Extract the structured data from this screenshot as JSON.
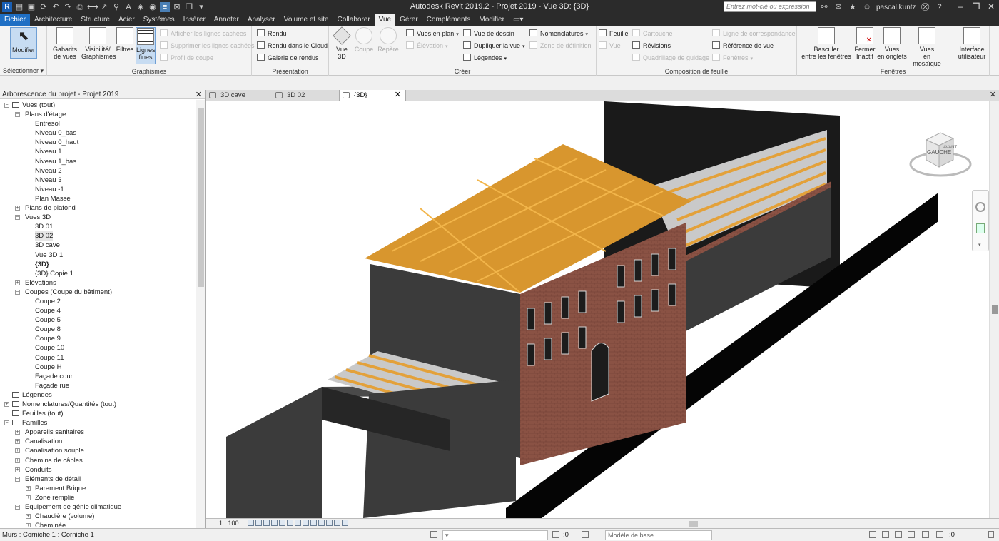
{
  "titlebar": {
    "title": "Autodesk Revit 2019.2 - Projet 2019 - Vue 3D: {3D}",
    "search_placeholder": "Entrez mot-clé ou expression",
    "user": "pascal.kuntz",
    "help": "?"
  },
  "menu": [
    "Fichier",
    "Architecture",
    "Structure",
    "Acier",
    "Systèmes",
    "Insérer",
    "Annoter",
    "Analyser",
    "Volume et site",
    "Collaborer",
    "Vue",
    "Gérer",
    "Compléments",
    "Modifier"
  ],
  "menu_active": "Vue",
  "ribbon": {
    "selectionner": {
      "modifier": "Modifier",
      "label": "Sélectionner"
    },
    "graphismes": {
      "label": "Graphismes",
      "gabarits": [
        "Gabarits",
        "de vues"
      ],
      "visibilite": [
        "Visibilité/",
        "Graphismes"
      ],
      "filtres": "Filtres",
      "lignes": [
        "Lignes",
        "fines"
      ],
      "afficher": "Afficher les lignes cachées",
      "supprimer": "Supprimer les lignes cachées",
      "profil": "Profil de coupe"
    },
    "presentation": {
      "label": "Présentation",
      "rendu": "Rendu",
      "rendu_cloud": "Rendu  dans le Cloud",
      "galerie": "Galerie  de rendus"
    },
    "creer": {
      "label": "Créer",
      "vue3d": [
        "Vue",
        "3D"
      ],
      "coupe": "Coupe",
      "repere": "Repère",
      "vues_plan": "Vues en plan",
      "elevation": "Élévation",
      "vue_dessin": "Vue de dessin",
      "dupliquer": "Dupliquer la vue",
      "legendes": "Légendes",
      "nomenclatures": "Nomenclatures",
      "zone_def": "Zone de définition"
    },
    "composition": {
      "label": "Composition de feuille",
      "feuille": "Feuille",
      "vue": "Vue",
      "cartouche": "Cartouche",
      "revisions": "Révisions",
      "quadrillage": "Quadrillage de guidage",
      "ligne_corr": "Ligne de correspondance",
      "reference": "Référence de vue",
      "fenetres_dd": "Fenêtres"
    },
    "fenetres": {
      "label": "Fenêtres",
      "basculer": [
        "Basculer",
        "entre les fenêtres"
      ],
      "fermer": [
        "Fermer",
        "Inactif"
      ],
      "onglets": [
        "Vues",
        "en onglets"
      ],
      "mosaique": [
        "Vues",
        "en mosaïque"
      ],
      "interface": [
        "Interface",
        "utilisateur"
      ]
    }
  },
  "browser": {
    "title": "Arborescence du projet - Projet 2019",
    "nodes": [
      {
        "label": "Vues (tout)",
        "level": 0,
        "exp": "−",
        "icon": "views-icon"
      },
      {
        "label": "Plans d'étage",
        "level": 1,
        "exp": "−"
      },
      {
        "label": "Entresol",
        "level": 2
      },
      {
        "label": "Niveau 0_bas",
        "level": 2
      },
      {
        "label": "Niveau 0_haut",
        "level": 2
      },
      {
        "label": "Niveau 1",
        "level": 2
      },
      {
        "label": "Niveau 1_bas",
        "level": 2
      },
      {
        "label": "Niveau 2",
        "level": 2
      },
      {
        "label": "Niveau 3",
        "level": 2
      },
      {
        "label": "Niveau -1",
        "level": 2
      },
      {
        "label": "Plan Masse",
        "level": 2
      },
      {
        "label": "Plans de plafond",
        "level": 1,
        "exp": "+"
      },
      {
        "label": "Vues 3D",
        "level": 1,
        "exp": "−"
      },
      {
        "label": "3D 01",
        "level": 2
      },
      {
        "label": "3D 02",
        "level": 2,
        "hl": true
      },
      {
        "label": "3D cave",
        "level": 2
      },
      {
        "label": "Vue 3D 1",
        "level": 2
      },
      {
        "label": "{3D}",
        "level": 2,
        "bold": true
      },
      {
        "label": "{3D} Copie 1",
        "level": 2
      },
      {
        "label": "Elévations",
        "level": 1,
        "exp": "+"
      },
      {
        "label": "Coupes (Coupe du bâtiment)",
        "level": 1,
        "exp": "−"
      },
      {
        "label": "Coupe 2",
        "level": 2
      },
      {
        "label": "Coupe 4",
        "level": 2
      },
      {
        "label": "Coupe 5",
        "level": 2
      },
      {
        "label": "Coupe 8",
        "level": 2
      },
      {
        "label": "Coupe 9",
        "level": 2
      },
      {
        "label": "Coupe 10",
        "level": 2
      },
      {
        "label": "Coupe 11",
        "level": 2
      },
      {
        "label": "Coupe H",
        "level": 2
      },
      {
        "label": "Façade cour",
        "level": 2
      },
      {
        "label": "Façade rue",
        "level": 2
      },
      {
        "label": "Légendes",
        "level": 0,
        "icon": "legend-icon"
      },
      {
        "label": "Nomenclatures/Quantités (tout)",
        "level": 0,
        "exp": "+",
        "icon": "schedule-icon"
      },
      {
        "label": "Feuilles (tout)",
        "level": 0,
        "icon": "sheet-icon"
      },
      {
        "label": "Familles",
        "level": 0,
        "exp": "−",
        "icon": "family-icon"
      },
      {
        "label": "Appareils sanitaires",
        "level": 1,
        "exp": "+"
      },
      {
        "label": "Canalisation",
        "level": 1,
        "exp": "+"
      },
      {
        "label": "Canalisation souple",
        "level": 1,
        "exp": "+"
      },
      {
        "label": "Chemins de câbles",
        "level": 1,
        "exp": "+"
      },
      {
        "label": "Conduits",
        "level": 1,
        "exp": "+"
      },
      {
        "label": "Eléments de détail",
        "level": 1,
        "exp": "−"
      },
      {
        "label": "Parement Brique",
        "level": 2,
        "exp": "+"
      },
      {
        "label": "Zone remplie",
        "level": 2,
        "exp": "+"
      },
      {
        "label": "Equipement de génie climatique",
        "level": 1,
        "exp": "−"
      },
      {
        "label": "Chaudière (volume)",
        "level": 2,
        "exp": "+"
      },
      {
        "label": "Cheminée",
        "level": 2,
        "exp": "+"
      }
    ]
  },
  "viewtabs": [
    {
      "label": "3D cave",
      "active": false
    },
    {
      "label": "3D 02",
      "active": false
    },
    {
      "label": "{3D}",
      "active": true
    }
  ],
  "viewcube": {
    "face": "GAUCHE",
    "side": "AVANT"
  },
  "viewbar": {
    "scale": "1 : 100"
  },
  "status": {
    "message": "Murs : Corniche 1 : Corniche 1",
    "zero1": ":0",
    "model": "Modèle de base",
    "zero2": ":0"
  }
}
